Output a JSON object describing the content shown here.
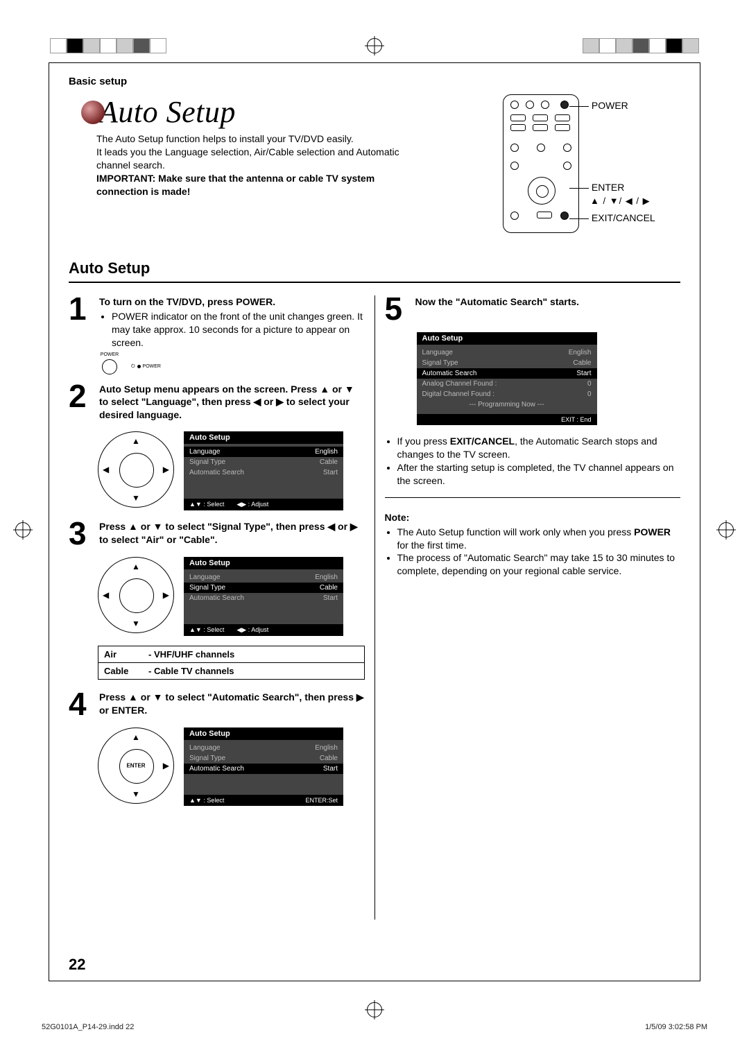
{
  "header": {
    "section": "Basic setup"
  },
  "title": "Auto Setup",
  "intro": {
    "line1": "The Auto Setup function helps to install your TV/DVD easily.",
    "line2": "It leads you the Language selection, Air/Cable selection and Automatic channel search.",
    "important": "IMPORTANT: Make sure that the antenna or cable TV system connection is made!"
  },
  "remote_labels": {
    "power": "POWER",
    "enter": "ENTER",
    "arrows": "▲ / ▼/ ◀ / ▶",
    "exit": "EXIT/CANCEL"
  },
  "section_heading": "Auto Setup",
  "steps": {
    "s1": {
      "num": "1",
      "head": "To turn on the TV/DVD, press POWER.",
      "bullet": "POWER indicator on the front of the unit changes green. It may take approx. 10 seconds for a picture to appear on screen.",
      "pow_label": "POWER",
      "pow_led": "POWER"
    },
    "s2": {
      "num": "2",
      "head": "Auto Setup menu appears on the screen. Press ▲ or ▼ to select \"Language\", then press ◀ or ▶ to select your desired language."
    },
    "s3": {
      "num": "3",
      "head": "Press ▲ or ▼ to select \"Signal Type\", then press ◀ or ▶ to select \"Air\" or \"Cable\"."
    },
    "s4": {
      "num": "4",
      "head": "Press ▲ or ▼ to select \"Automatic Search\", then press ▶ or ENTER."
    },
    "s5": {
      "num": "5",
      "head": "Now the \"Automatic Search\" starts.",
      "bullet1": "If you press EXIT/CANCEL, the Automatic Search stops and changes to the TV screen.",
      "bullet1_pre": "If you press ",
      "bullet1_bold": "EXIT/CANCEL",
      "bullet1_post": ", the Automatic Search stops and changes to the TV screen.",
      "bullet2": "After the starting setup is completed, the TV channel appears on the screen."
    }
  },
  "osd": {
    "title": "Auto Setup",
    "rows": {
      "language_k": "Language",
      "language_v": "English",
      "signal_k": "Signal Type",
      "signal_v": "Cable",
      "search_k": "Automatic Search",
      "search_v": "Start",
      "analog_k": "Analog Channel Found :",
      "analog_v": "0",
      "digital_k": "Digital Channel Found :",
      "digital_v": "0",
      "prog": "--- Programming Now ---"
    },
    "foot_select": "▲▼ : Select",
    "foot_adjust": "◀▶ : Adjust",
    "foot_enter": "ENTER:Set",
    "foot_exit": "EXIT : End"
  },
  "defs": {
    "air_k": "Air",
    "air_v": "- VHF/UHF channels",
    "cable_k": "Cable",
    "cable_v": "- Cable TV channels"
  },
  "note": {
    "head": "Note:",
    "n1_pre": "The Auto Setup function will work only when you press ",
    "n1_bold": "POWER",
    "n1_post": " for the first time.",
    "n2": "The process of \"Automatic Search\" may take 15 to 30 minutes to complete, depending on your regional cable service."
  },
  "page_number": "22",
  "footer": {
    "file": "52G0101A_P14-29.indd   22",
    "date": "1/5/09   3:02:58 PM"
  }
}
